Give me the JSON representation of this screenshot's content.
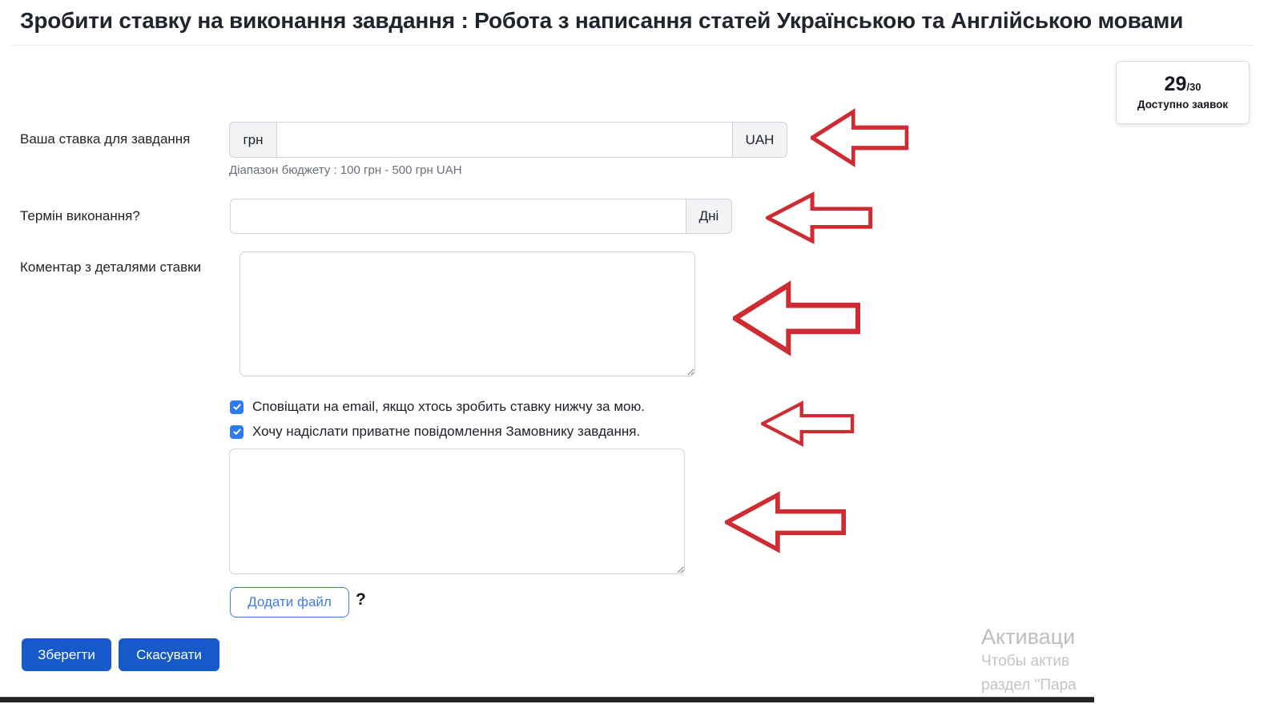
{
  "page": {
    "title": "Зробити ставку на виконання завдання : Робота з написання статей Українською та Англійською мовами"
  },
  "quota": {
    "count": "29",
    "total": "/30",
    "label": "Доступно заявок"
  },
  "form": {
    "bid": {
      "label": "Ваша ставка для завдання",
      "prefix": "грн",
      "value": "",
      "suffix": "UAH",
      "helper": "Діапазон бюджету : 100 грн - 500 грн UAH"
    },
    "term": {
      "label": "Термін виконання?",
      "value": "",
      "suffix": "Дні"
    },
    "comment": {
      "label": "Коментар з деталями ставки",
      "value": ""
    },
    "notify_checkbox": {
      "label": "Сповіщати на email, якщо хтось зробить ставку нижчу за мою.",
      "checked": true
    },
    "private_checkbox": {
      "label": "Хочу надіслати приватне повідомлення Замовнику завдання.",
      "checked": true
    },
    "private_message": {
      "value": ""
    },
    "add_file_label": "Додати файл",
    "help_mark": "?",
    "save_label": "Зберегти",
    "cancel_label": "Скасувати"
  },
  "annotations": {
    "arrow_count": 5,
    "arrow_color": "#cf2b33"
  },
  "watermark": {
    "lines": [
      "Активаци",
      "Чтобы актив",
      "раздел \"Пара"
    ]
  },
  "colors": {
    "accent_blue": "#1659c9",
    "checkbox_blue": "#2d7af2",
    "outline_blue": "#3e7fe0",
    "arrow_red": "#cf2b33",
    "addon_bg": "#f1f3f5",
    "input_border": "#ced4da",
    "muted_text": "#6a7077",
    "watermark_gray": "#bdbec0",
    "title_color": "#20242c",
    "card_border": "#d9dde1"
  }
}
